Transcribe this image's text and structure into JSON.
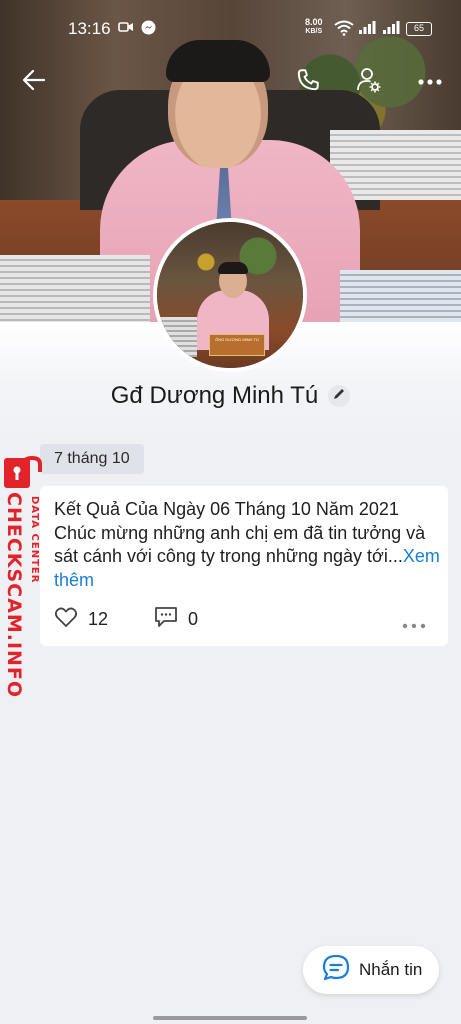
{
  "status_bar": {
    "time": "13:16",
    "speed_value": "8.00",
    "speed_unit": "KB/S",
    "battery": "65"
  },
  "header": {
    "back_icon": "arrow-left-icon",
    "call_icon": "phone-icon",
    "settings_icon": "user-settings-icon",
    "more_icon": "more-horizontal-icon"
  },
  "profile": {
    "name": "Gđ Dương Minh Tú",
    "avatar_plate_text": "ÔNG DƯƠNG MINH TÚ"
  },
  "feed": {
    "date_label": "7 tháng 10",
    "post": {
      "text": "Kết Quả Của Ngày 06 Tháng 10 Năm 2021 Chúc mừng những anh chị em đã tin tưởng và sát cánh với công ty trong những ngày tới...",
      "see_more": "Xem thêm",
      "likes": "12",
      "comments": "0"
    }
  },
  "watermark": {
    "main": "CHECKSCAM.INFO",
    "sub": "DATA CENTER"
  },
  "message_button": {
    "label": "Nhắn tin"
  },
  "colors": {
    "link": "#1a7fd8",
    "watermark": "#e2232a",
    "background": "#eef0f4"
  }
}
